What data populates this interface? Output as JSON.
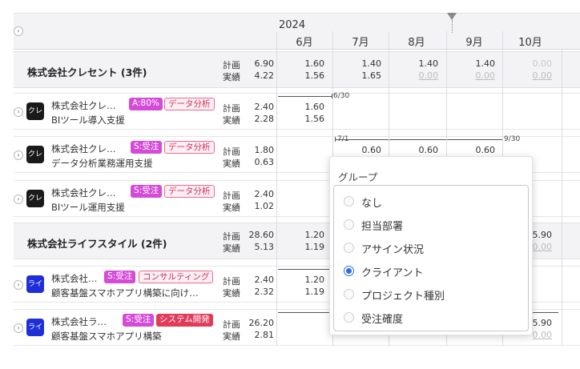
{
  "header": {
    "year": "2024",
    "months": [
      "6月",
      "7月",
      "8月",
      "9月",
      "10月"
    ]
  },
  "labels": {
    "plan": "計画",
    "actual": "実績"
  },
  "groups": [
    {
      "title": "株式会社クレセント (3件)",
      "plan": "6.90",
      "actual": "4.22",
      "months_plan": [
        "1.60",
        "1.40",
        "1.40",
        "1.40",
        "0.00"
      ],
      "months_actual": [
        "1.56",
        "1.65",
        "0.00",
        "0.00",
        "0.00"
      ]
    },
    {
      "title": "株式会社ライフスタイル (2件)",
      "plan": "28.60",
      "actual": "5.13",
      "months_plan": [
        "1.20",
        "",
        "",
        "",
        "5.90"
      ],
      "months_actual": [
        "1.19",
        "",
        "",
        "",
        "0.00"
      ]
    }
  ],
  "tasks": [
    {
      "avatar": "クレ",
      "client": "株式会社クレ…",
      "badges": [
        "A:80%",
        "データ分析"
      ],
      "name": "BIツール導入支援",
      "plan": "2.40",
      "actual": "2.28",
      "m_plan": "1.60",
      "m_actual": "1.56",
      "bar_end": "6/30"
    },
    {
      "avatar": "クレ",
      "client": "株式会社クレ…",
      "badges": [
        "S:受注",
        "データ分析"
      ],
      "name": "データ分析業務運用支援",
      "plan": "1.80",
      "actual": "0.63",
      "m_plan": [
        "0.60",
        "0.60",
        "0.60"
      ],
      "bar_start": "7/1",
      "bar_end": "9/30"
    },
    {
      "avatar": "クレ",
      "client": "株式会社クレ…",
      "badges": [
        "S:受注",
        "データ分析"
      ],
      "name": "BIツール運用支援",
      "plan": "2.40",
      "actual": "1.02"
    },
    {
      "avatar": "ライ",
      "client": "株式会社…",
      "badges": [
        "S:受注",
        "コンサルティング"
      ],
      "name": "顧客基盤スマホアプリ構築に向け…",
      "plan": "2.40",
      "actual": "2.32",
      "m_plan": "1.20",
      "m_actual": "1.19"
    },
    {
      "avatar": "ライ",
      "client": "株式会社ラ…",
      "badges": [
        "S:受注",
        "システム開発"
      ],
      "name": "顧客基盤スマホアプリ構築",
      "plan": "26.20",
      "actual": "2.81",
      "m_plan_oct": "5.90",
      "m_actual_oct": "0.00"
    }
  ],
  "popup": {
    "title": "グループ",
    "options": [
      "なし",
      "担当部署",
      "アサイン状況",
      "クライアント",
      "プロジェクト種別",
      "受注確度"
    ],
    "selected": "クライアント"
  },
  "colors": {
    "accent": "#2a6fe0",
    "badge_magenta": "#d44bd8",
    "badge_pink": "#e86c90",
    "badge_red": "#e23b5a"
  }
}
